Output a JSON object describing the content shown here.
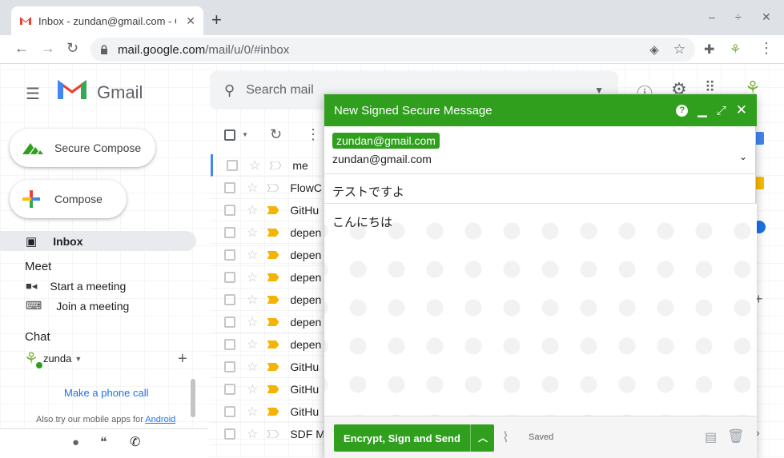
{
  "browser": {
    "tab_title": "Inbox - zundan@gmail.com - Gmail",
    "new_tab": "+",
    "url_host": "mail.google.com",
    "url_path": "/mail/u/0/#inbox"
  },
  "gmail": {
    "product_name": "Gmail",
    "search_placeholder": "Search mail",
    "secure_compose": "Secure Compose",
    "compose": "Compose",
    "inbox": "Inbox",
    "meet_title": "Meet",
    "start_meeting": "Start a meeting",
    "join_meeting": "Join a meeting",
    "chat_title": "Chat",
    "chat_user": "zunda",
    "phone_call": "Make a phone call",
    "mobile_tip": "Also try our mobile apps for",
    "mobile_tip_link": "Android"
  },
  "mail_rows": [
    {
      "sender": "me"
    },
    {
      "sender": "FlowC"
    },
    {
      "sender": "GitHu"
    },
    {
      "sender": "depen"
    },
    {
      "sender": "depen"
    },
    {
      "sender": "depen"
    },
    {
      "sender": "depen"
    },
    {
      "sender": "depen"
    },
    {
      "sender": "depen"
    },
    {
      "sender": "GitHu"
    },
    {
      "sender": "GitHu"
    },
    {
      "sender": "GitHu"
    },
    {
      "sender": "SDF M"
    }
  ],
  "compose": {
    "title": "New Signed Secure Message",
    "recipient_chip": "zundan@gmail.com",
    "from": "zundan@gmail.com",
    "subject": "テストですよ",
    "body": "こんにちは",
    "send_label": "Encrypt, Sign and Send",
    "saved": "Saved"
  },
  "colors": {
    "accent_green": "#2f9f1d",
    "link_blue": "#1a73e8"
  }
}
